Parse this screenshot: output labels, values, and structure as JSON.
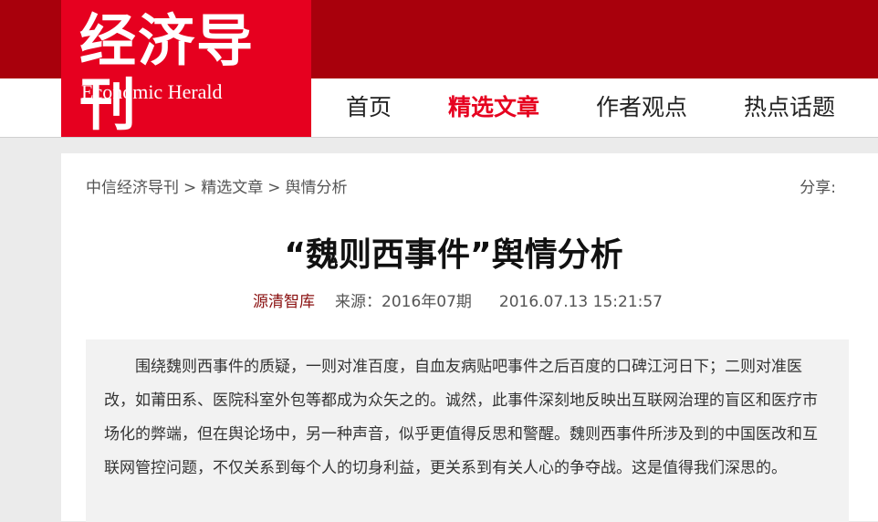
{
  "logo": {
    "cn": "经济导刊",
    "en": "Economic Herald"
  },
  "nav": {
    "items": [
      "首页",
      "精选文章",
      "作者观点",
      "热点话题"
    ],
    "active_index": 1
  },
  "breadcrumb": {
    "items": [
      "中信经济导刊",
      "精选文章",
      "舆情分析"
    ],
    "separator": ">"
  },
  "share_label": "分享:",
  "article": {
    "title": "“魏则西事件”舆情分析",
    "author": "源清智库",
    "source": "来源：2016年07期",
    "datetime": "2016.07.13 15:21:57",
    "abstract": "围绕魏则西事件的质疑，一则对准百度，自血友病贴吧事件之后百度的口碑江河日下；二则对准医改，如莆田系、医院科室外包等都成为众矢之的。诚然，此事件深刻地反映出互联网治理的盲区和医疗市场化的弊端，但在舆论场中，另一种声音，似乎更值得反思和警醒。魏则西事件所涉及到的中国医改和互联网管控问题，不仅关系到每个人的切身利益，更关系到有关人心的争夺战。这是值得我们深思的。"
  },
  "colors": {
    "header_dark_red": "#a8000c",
    "logo_red": "#e6001f",
    "active_nav": "#e6001f",
    "author": "#8a1010"
  }
}
